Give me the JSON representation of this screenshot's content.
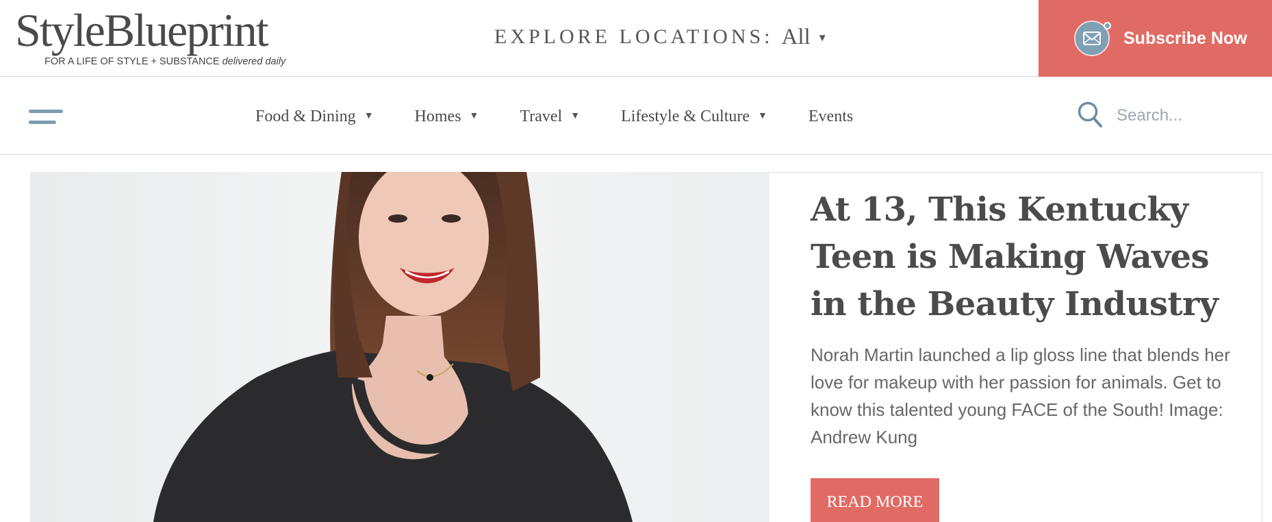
{
  "header": {
    "logo_text": "StyleBlueprint",
    "tagline_main": "FOR A LIFE OF STYLE + SUBSTANCE ",
    "tagline_emph": "delivered daily",
    "explore_label": "EXPLORE LOCATIONS:",
    "explore_value": "All",
    "subscribe_label": "Subscribe Now",
    "subscribe_icon": "mail-icon"
  },
  "nav": {
    "menu_icon": "hamburger-icon",
    "items": [
      {
        "label": "Food & Dining",
        "has_dropdown": true
      },
      {
        "label": "Homes",
        "has_dropdown": true
      },
      {
        "label": "Travel",
        "has_dropdown": true
      },
      {
        "label": "Lifestyle & Culture",
        "has_dropdown": true
      },
      {
        "label": "Events",
        "has_dropdown": false
      }
    ],
    "search_placeholder": "Search...",
    "search_icon": "search-icon"
  },
  "hero": {
    "title": "At 13, This Kentucky Teen is Making Waves in the Beauty Industry",
    "description": "Norah Martin launched a lip gloss line that blends her love for makeup with her passion for animals. Get to know this talented young FACE of the South! Image: Andrew Kung",
    "cta": "READ MORE"
  },
  "colors": {
    "accent": "#e06b65",
    "nav_icon": "#7b9cb0",
    "text_dark": "#4a4a4a"
  }
}
